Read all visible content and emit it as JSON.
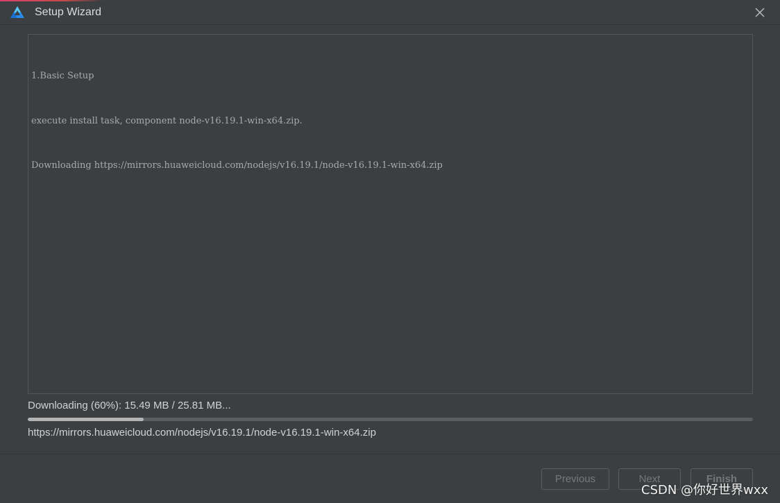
{
  "window": {
    "title": "Setup Wizard",
    "app_icon": "deveco-logo-icon",
    "close_icon": "close-icon"
  },
  "log": {
    "lines": [
      "1.Basic Setup",
      "execute install task, component node-v16.19.1-win-x64.zip.",
      "Downloading https://mirrors.huaweicloud.com/nodejs/v16.19.1/node-v16.19.1-win-x64.zip"
    ]
  },
  "progress": {
    "status_text": "Downloading (60%): 15.49 MB / 25.81 MB...",
    "percent": 16,
    "url": "https://mirrors.huaweicloud.com/nodejs/v16.19.1/node-v16.19.1-win-x64.zip"
  },
  "buttons": {
    "previous": "Previous",
    "next": "Next",
    "finish": "Finish"
  },
  "watermark": "CSDN @你好世界wxx",
  "colors": {
    "background": "#3c3f41",
    "progress_fill": "#b3b3b3",
    "progress_track": "#5a5d5f",
    "accent": "#d9416b"
  }
}
